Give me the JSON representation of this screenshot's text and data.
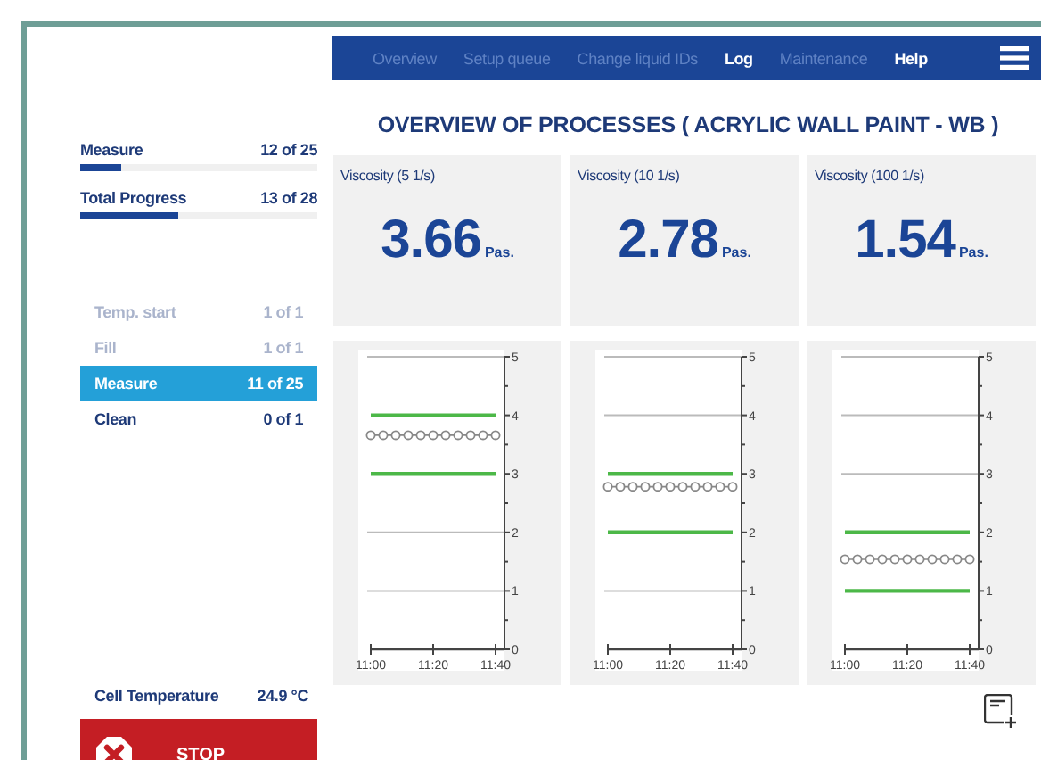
{
  "nav": {
    "items": [
      {
        "label": "Overview",
        "disabled": true
      },
      {
        "label": "Setup queue",
        "disabled": true
      },
      {
        "label": "Change liquid IDs",
        "disabled": true
      },
      {
        "label": "Log",
        "disabled": false
      },
      {
        "label": "Maintenance",
        "disabled": true
      },
      {
        "label": "Help",
        "disabled": false
      }
    ]
  },
  "progress": [
    {
      "label": "Measure",
      "count": "12 of 25",
      "level": 0.17
    },
    {
      "label": "Total Progress",
      "count": "13 of 28",
      "level": 0.41
    }
  ],
  "steps": [
    {
      "label": "Temp. start",
      "count": "1 of 1",
      "done": true,
      "selected": false
    },
    {
      "label": "Fill",
      "count": "1 of 1",
      "done": true,
      "selected": false
    },
    {
      "label": "Measure",
      "count": "11 of 25",
      "done": false,
      "selected": true
    },
    {
      "label": "Clean",
      "count": "0 of 1",
      "done": false,
      "selected": false
    }
  ],
  "cell_temperature": {
    "label": "Cell Temperature",
    "value": "24.9 °C"
  },
  "stop_button": {
    "label": "STOP"
  },
  "title": "OVERVIEW OF PROCESSES ( ACRYLIC WALL PAINT - WB )",
  "cards": [
    {
      "label": "Viscosity (5 1/s)",
      "value": "3.66",
      "unit": "Pas.",
      "chart_data": {
        "type": "line",
        "categories": [
          "11:00",
          null,
          null,
          null,
          null,
          "11:20",
          null,
          null,
          null,
          null,
          "11:40"
        ],
        "ylim": [
          0,
          5
        ],
        "yticks": [
          0,
          1,
          2,
          3,
          4,
          5
        ],
        "series": [
          {
            "color": "#888888",
            "marker": "circle",
            "values": [
              3.66,
              3.66,
              3.66,
              3.66,
              3.66,
              3.66,
              3.66,
              3.66,
              3.66,
              3.66,
              3.66
            ]
          },
          {
            "color": "#4cb848",
            "values": [
              4,
              4,
              4,
              4,
              4,
              4,
              4,
              4,
              4,
              4,
              4
            ]
          },
          {
            "color": "#4cb848",
            "values": [
              3,
              3,
              3,
              3,
              3,
              3,
              3,
              3,
              3,
              3,
              3
            ]
          }
        ]
      }
    },
    {
      "label": "Viscosity (10 1/s)",
      "value": "2.78",
      "unit": "Pas.",
      "chart_data": {
        "type": "line",
        "categories": [
          "11:00",
          null,
          null,
          null,
          null,
          "11:20",
          null,
          null,
          null,
          null,
          "11:40"
        ],
        "ylim": [
          0,
          5
        ],
        "yticks": [
          0,
          1,
          2,
          3,
          4,
          5
        ],
        "series": [
          {
            "color": "#888888",
            "marker": "circle",
            "values": [
              2.78,
              2.78,
              2.78,
              2.78,
              2.78,
              2.78,
              2.78,
              2.78,
              2.78,
              2.78,
              2.78
            ]
          },
          {
            "color": "#4cb848",
            "values": [
              3,
              3,
              3,
              3,
              3,
              3,
              3,
              3,
              3,
              3,
              3
            ]
          },
          {
            "color": "#4cb848",
            "values": [
              2,
              2,
              2,
              2,
              2,
              2,
              2,
              2,
              2,
              2,
              2
            ]
          }
        ]
      }
    },
    {
      "label": "Viscosity (100 1/s)",
      "value": "1.54",
      "unit": "Pas.",
      "chart_data": {
        "type": "line",
        "categories": [
          "11:00",
          null,
          null,
          null,
          null,
          "11:20",
          null,
          null,
          null,
          null,
          "11:40"
        ],
        "ylim": [
          0,
          5
        ],
        "yticks": [
          0,
          1,
          2,
          3,
          4,
          5
        ],
        "series": [
          {
            "color": "#888888",
            "marker": "circle",
            "values": [
              1.54,
              1.54,
              1.54,
              1.54,
              1.54,
              1.54,
              1.54,
              1.54,
              1.54,
              1.54,
              1.54
            ]
          },
          {
            "color": "#4cb848",
            "values": [
              2,
              2,
              2,
              2,
              2,
              2,
              2,
              2,
              2,
              2,
              2
            ]
          },
          {
            "color": "#4cb848",
            "values": [
              1,
              1,
              1,
              1,
              1,
              1,
              1,
              1,
              1,
              1,
              1
            ]
          }
        ]
      }
    }
  ]
}
